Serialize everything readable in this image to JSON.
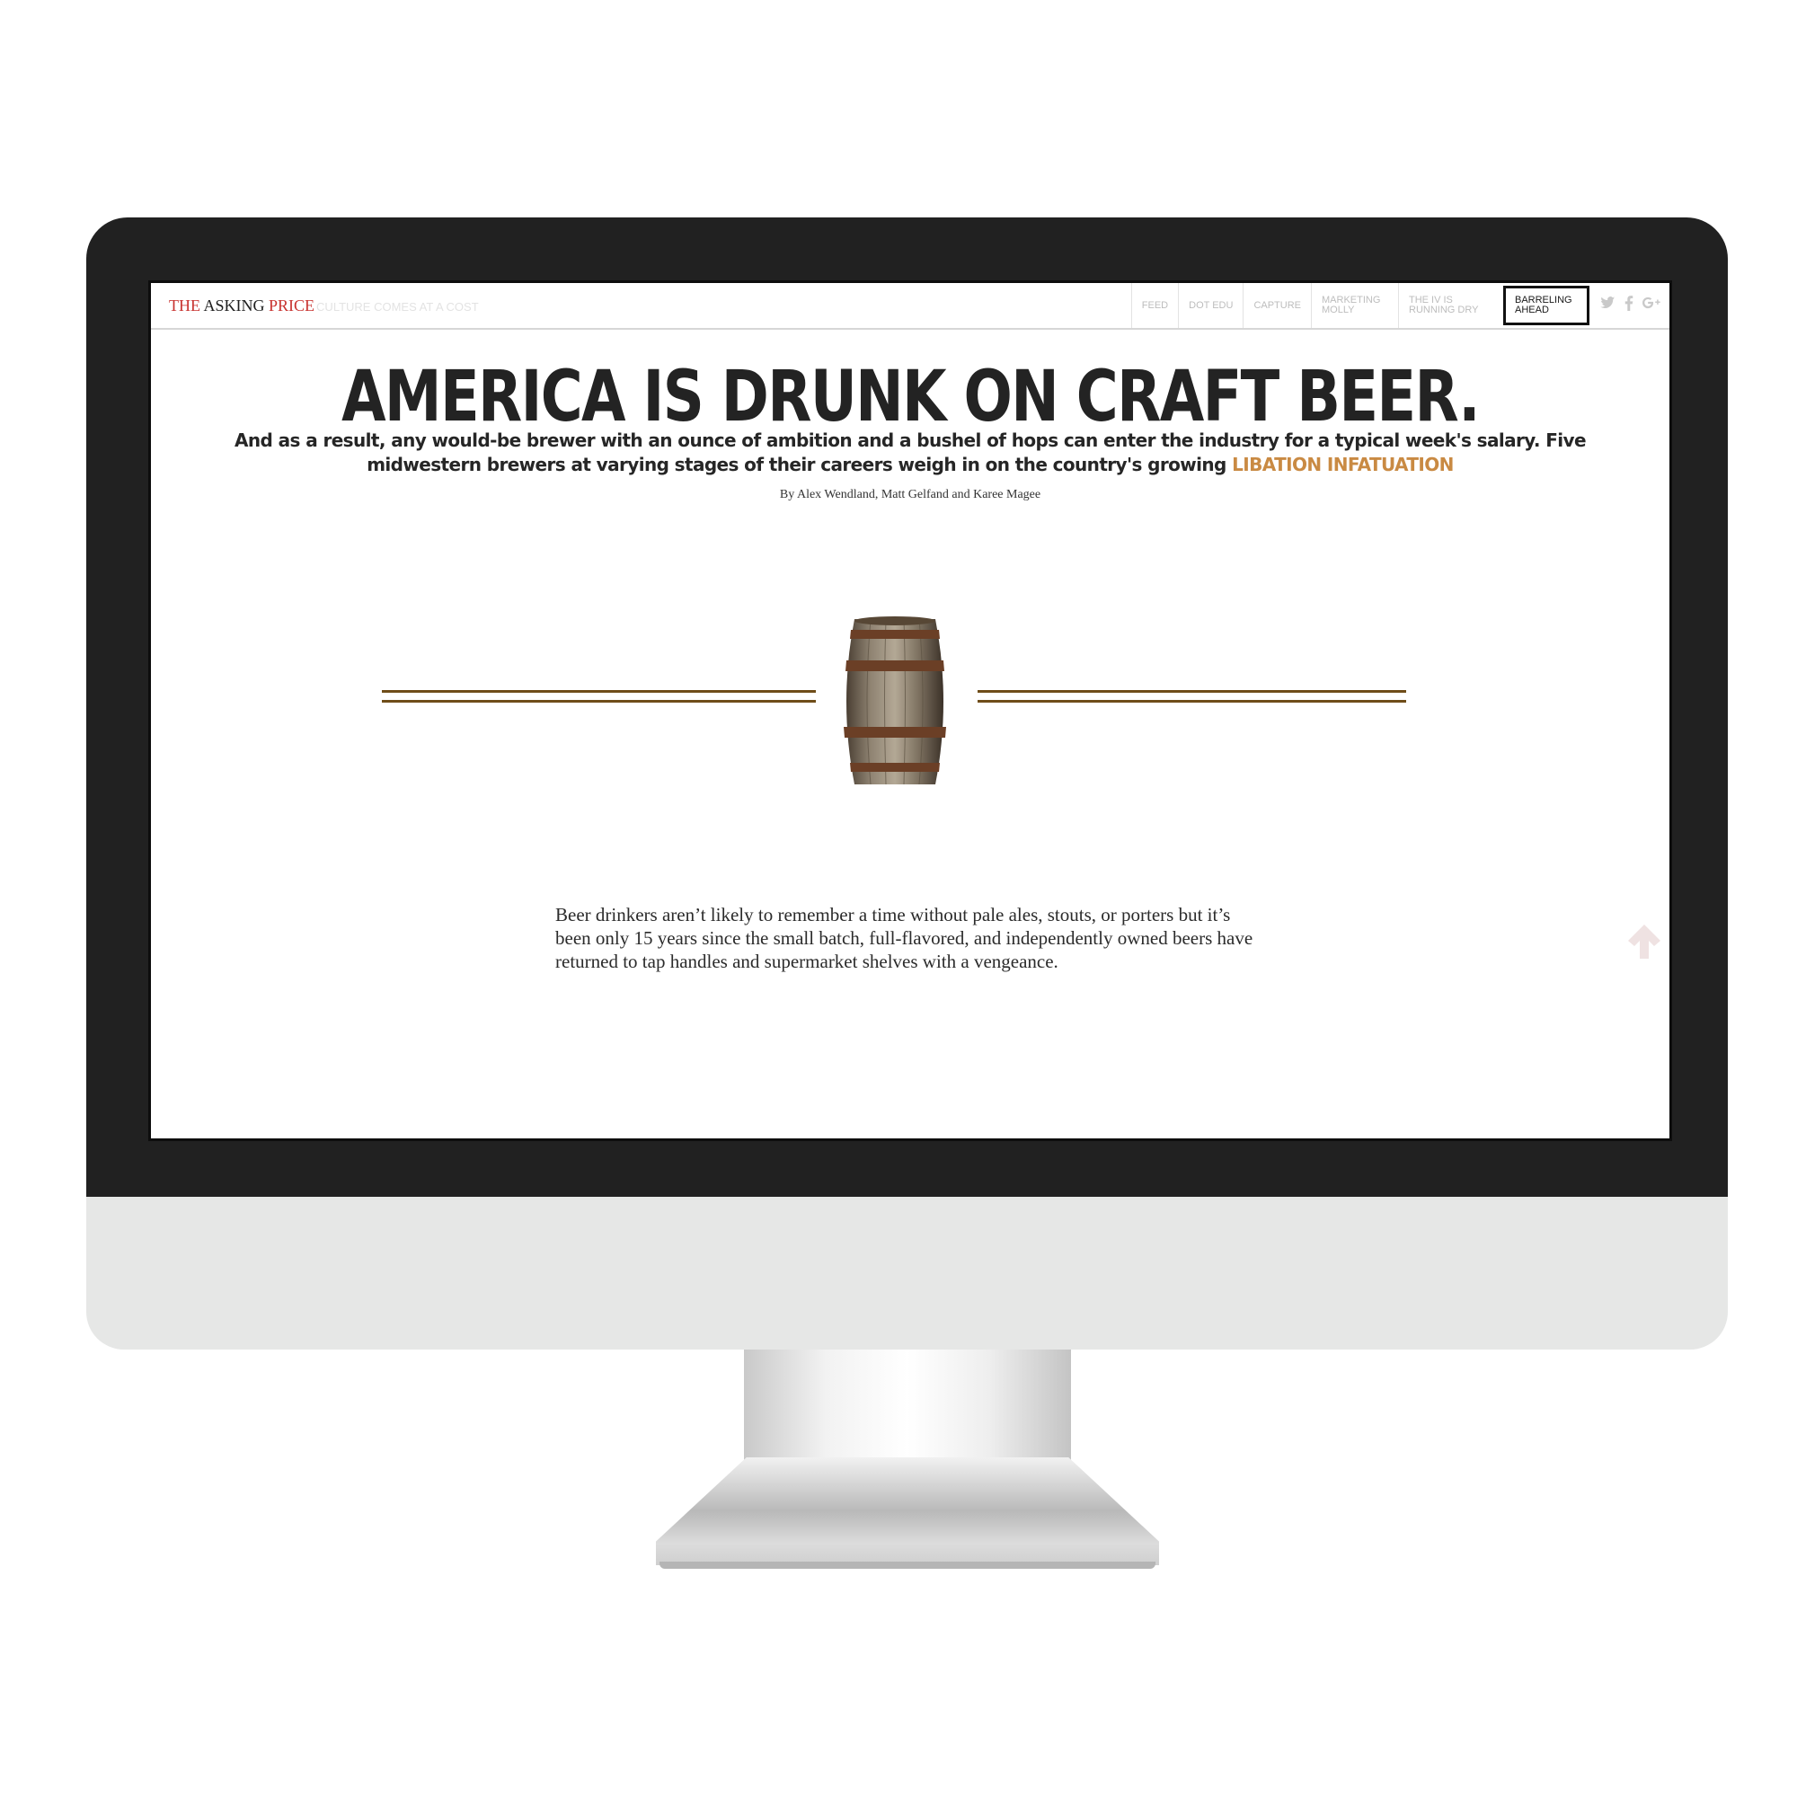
{
  "brand": {
    "the": "THE",
    "asking": "ASKING",
    "price": "PRICE",
    "tagline": "CULTURE COMES AT A COST"
  },
  "nav": {
    "items": [
      {
        "label": "FEED"
      },
      {
        "label": "DOT EDU"
      },
      {
        "label": "CAPTURE"
      },
      {
        "label": "MARKETING MOLLY"
      },
      {
        "label": "THE IV IS RUNNING DRY"
      },
      {
        "label": "BARRELING AHEAD",
        "active": true
      }
    ],
    "social_icons": [
      "twitter-icon",
      "facebook-icon",
      "google-plus-icon"
    ]
  },
  "article": {
    "headline": "AMERICA IS DRUNK ON CRAFT BEER.",
    "dek": "And as a result, any would-be brewer with an ounce of ambition and a bushel of hops can enter the industry for a typical week's salary. Five midwestern brewers at varying stages of their careers weigh in on the country's growing",
    "dek_highlight": "LIBATION INFATUATION",
    "byline": "By Alex Wendland, Matt Gelfand and Karee Magee",
    "body": "Beer drinkers aren’t likely to remember a time without pale ales, stouts, or porters but it’s been only 15 years since the small batch, full-flavored, and independently owned beers have returned to tap handles and supermarket shelves with a vengeance."
  },
  "colors": {
    "brand_red": "#c8322f",
    "highlight": "#c98a43",
    "rule": "#6f4d19",
    "bezel": "#212121"
  }
}
